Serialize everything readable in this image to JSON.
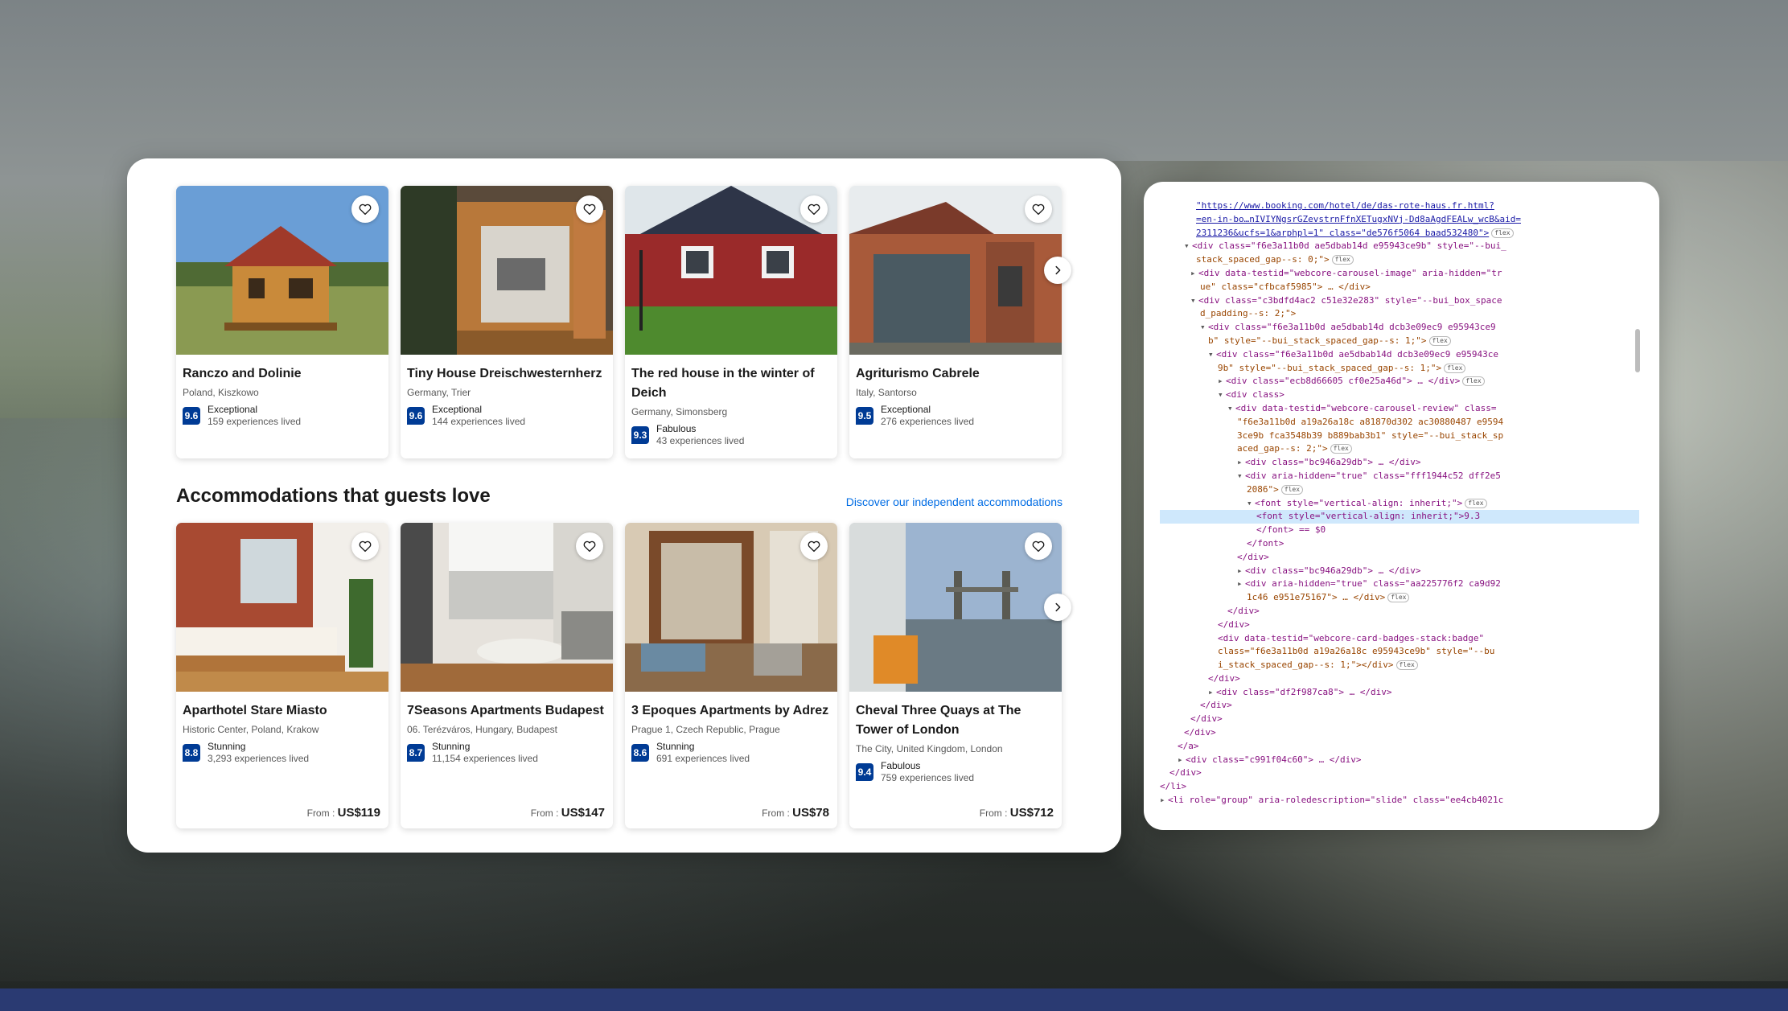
{
  "row1": [
    {
      "title": "Ranczo and Dolinie",
      "location": "Poland, Kiszkowo",
      "score": "9.6",
      "rating_word": "Exceptional",
      "reviews": "159 experiences lived"
    },
    {
      "title": "Tiny House Dreischwesternherz",
      "location": "Germany, Trier",
      "score": "9.6",
      "rating_word": "Exceptional",
      "reviews": "144 experiences lived"
    },
    {
      "title": "The red house in the winter of Deich",
      "location": "Germany, Simonsberg",
      "score": "9.3",
      "rating_word": "Fabulous",
      "reviews": "43 experiences lived"
    },
    {
      "title": "Agriturismo Cabrele",
      "location": "Italy, Santorso",
      "score": "9.5",
      "rating_word": "Exceptional",
      "reviews": "276 experiences lived"
    }
  ],
  "section": {
    "title": "Accommodations that guests love",
    "link": "Discover our independent accommodations"
  },
  "row2": [
    {
      "title": "Aparthotel Stare Miasto",
      "location": "Historic Center, Poland, Krakow",
      "score": "8.8",
      "rating_word": "Stunning",
      "reviews": "3,293 experiences lived",
      "price_prefix": "From : ",
      "price": "US$119"
    },
    {
      "title": "7Seasons Apartments Budapest",
      "location": "06. Terézváros, Hungary, Budapest",
      "score": "8.7",
      "rating_word": "Stunning",
      "reviews": "11,154 experiences lived",
      "price_prefix": "From : ",
      "price": "US$147"
    },
    {
      "title": "3 Epoques Apartments by Adrez",
      "location": "Prague 1, Czech Republic, Prague",
      "score": "8.6",
      "rating_word": "Stunning",
      "reviews": "691 experiences lived",
      "price_prefix": "From : ",
      "price": "US$78"
    },
    {
      "title": "Cheval Three Quays at The Tower of London",
      "location": "The City, United Kingdom, London",
      "score": "9.4",
      "rating_word": "Fabulous",
      "reviews": "759 experiences lived",
      "price_prefix": "From : ",
      "price": "US$712"
    }
  ],
  "icons": {
    "heart": "heart-icon",
    "next": "chevron-right-icon"
  },
  "colors": {
    "score_bg": "#003b95",
    "link": "#006ce4",
    "bottom_bar": "#2a3a72"
  },
  "devtools": {
    "lines": [
      "\"https://www.booking.com/hotel/de/das-rote-haus.fr.html?",
      "=en-in-bo…nIVIYNgsrGZevstrnFfnXETugxNVj-Dd8aAgdFEALw_wcB&aid=",
      "2311236&ucfs=1&arphpl=1\" class=\"de576f5064 baad532480\">",
      "<div class=\"f6e3a11b0d ae5dbab14d e95943ce9b\" style=\"--bui_",
      "stack_spaced_gap--s: 0;\">",
      "<div data-testid=\"webcore-carousel-image\" aria-hidden=\"tr",
      "ue\" class=\"cfbcaf5985\"> … </div>",
      "<div class=\"c3bdfd4ac2 c51e32e283\" style=\"--bui_box_space",
      "d_padding--s: 2;\">",
      "<div class=\"f6e3a11b0d ae5dbab14d dcb3e09ec9 e95943ce9",
      "b\" style=\"--bui_stack_spaced_gap--s: 1;\">",
      "<div class=\"f6e3a11b0d ae5dbab14d dcb3e09ec9 e95943ce",
      "9b\" style=\"--bui_stack_spaced_gap--s: 1;\">",
      "<div class=\"ecb8d66605 cf0e25a46d\"> … </div>",
      "<div class>",
      "<div data-testid=\"webcore-carousel-review\" class=",
      "\"f6e3a11b0d a19a26a18c a81870d302 ac30880487 e9594",
      "3ce9b fca3548b39 b889bab3b1\" style=\"--bui_stack_sp",
      "aced_gap--s: 2;\">",
      "<div class=\"bc946a29db\"> … </div>",
      "<div aria-hidden=\"true\" class=\"fff1944c52 dff2e5",
      "2086\">",
      "<font style=\"vertical-align: inherit;\">",
      "<font style=\"vertical-align: inherit;\">9.3",
      "</font> == $0",
      "</font>",
      "</div>",
      "<div class=\"bc946a29db\"> … </div>",
      "<div aria-hidden=\"true\" class=\"aa225776f2 ca9d92",
      "1c46 e951e75167\"> … </div>",
      "</div>",
      "</div>",
      "<div data-testid=\"webcore-card-badges-stack:badge\"",
      "class=\"f6e3a11b0d a19a26a18c e95943ce9b\" style=\"--bu",
      "i_stack_spaced_gap--s: 1;\"></div>",
      "</div>",
      "<div class=\"df2f987ca8\"> … </div>",
      "</div>",
      "</div>",
      "</div>",
      "</a>",
      "<div class=\"c991f04c60\"> … </div>",
      "</div>",
      "</li>",
      "<li role=\"group\" aria-roledescription=\"slide\" class=\"ee4cb4021c"
    ],
    "flex_badge": "flex"
  }
}
